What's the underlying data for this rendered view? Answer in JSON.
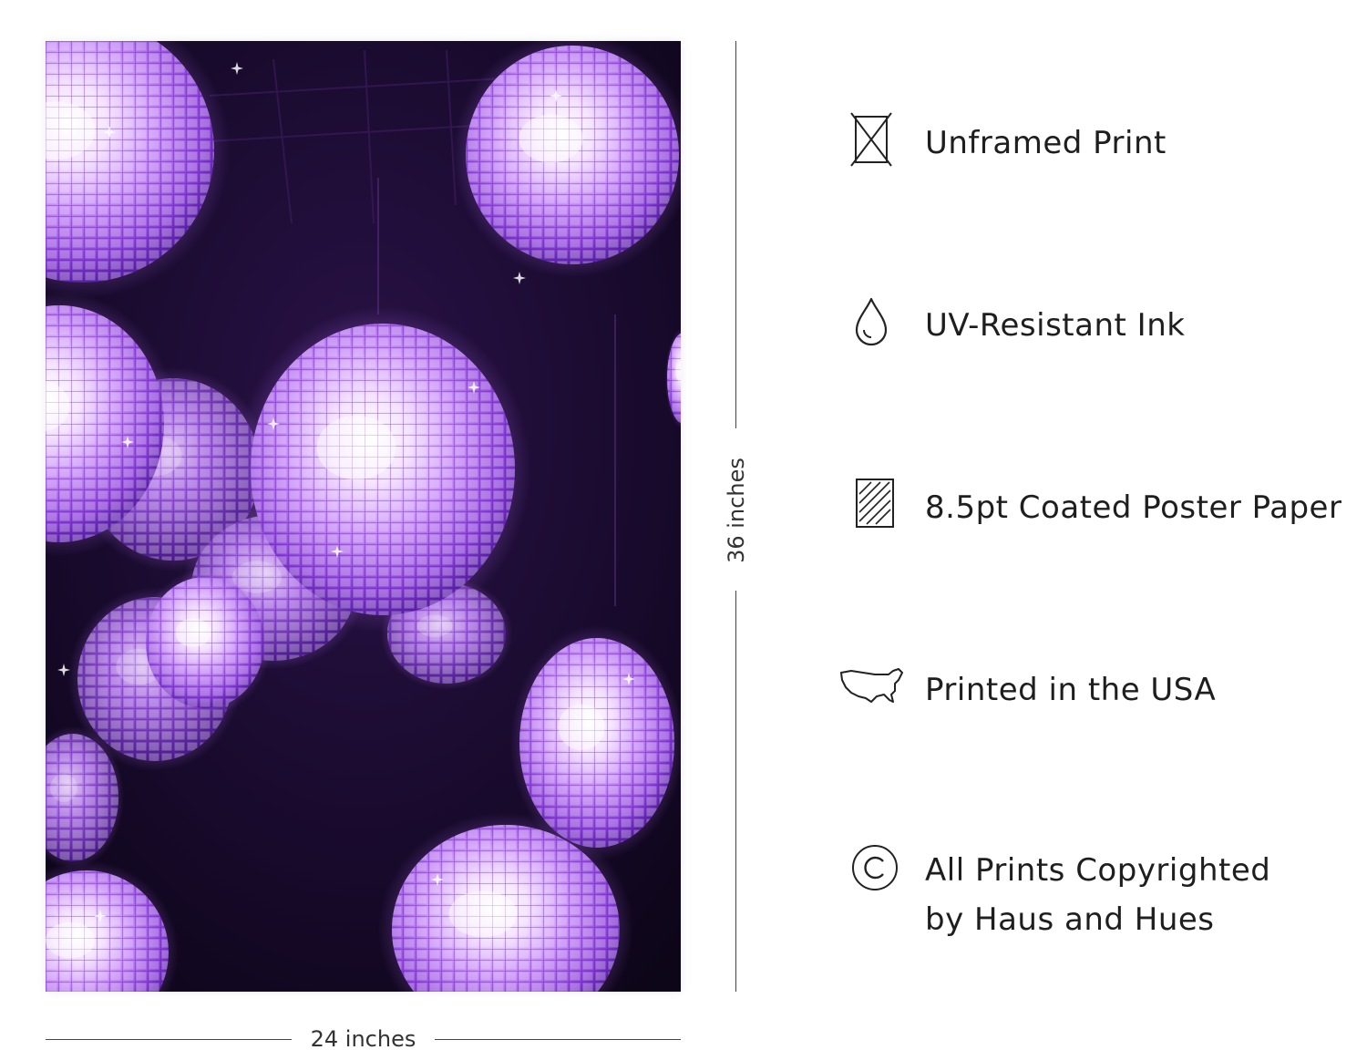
{
  "dimensions": {
    "width_label": "24 inches",
    "height_label": "36 inches"
  },
  "poster": {
    "subject": "purple disco balls",
    "accent_color": "#b06cf0",
    "background_color": "#150924"
  },
  "features": [
    {
      "icon": "unframed-icon",
      "label": "Unframed Print"
    },
    {
      "icon": "ink-drop-icon",
      "label": "UV-Resistant Ink"
    },
    {
      "icon": "paper-icon",
      "label": "8.5pt Coated Poster Paper"
    },
    {
      "icon": "usa-map-icon",
      "label": "Printed in the USA"
    },
    {
      "icon": "copyright-icon",
      "label": "All Prints Copyrighted\nby Haus and Hues"
    }
  ]
}
